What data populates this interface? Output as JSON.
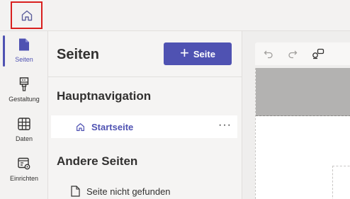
{
  "rail": {
    "items": [
      {
        "label": "Seiten",
        "icon": "page-icon",
        "active": true
      },
      {
        "label": "Gestaltung",
        "icon": "paintbrush-icon",
        "active": false
      },
      {
        "label": "Daten",
        "icon": "table-icon",
        "active": false
      },
      {
        "label": "Einrichten",
        "icon": "settings-panel-icon",
        "active": false
      }
    ]
  },
  "panel": {
    "title": "Seiten",
    "add_button_label": "Seite",
    "main_nav_title": "Hauptnavigation",
    "main_nav_pages": [
      {
        "label": "Startseite",
        "icon": "home-icon"
      }
    ],
    "other_title": "Andere Seiten",
    "other_pages": [
      {
        "label": "Seite nicht gefunden",
        "icon": "page-icon"
      }
    ],
    "more_label": "···"
  },
  "colors": {
    "accent": "#4f52b2",
    "highlight_border": "#d9201f"
  }
}
